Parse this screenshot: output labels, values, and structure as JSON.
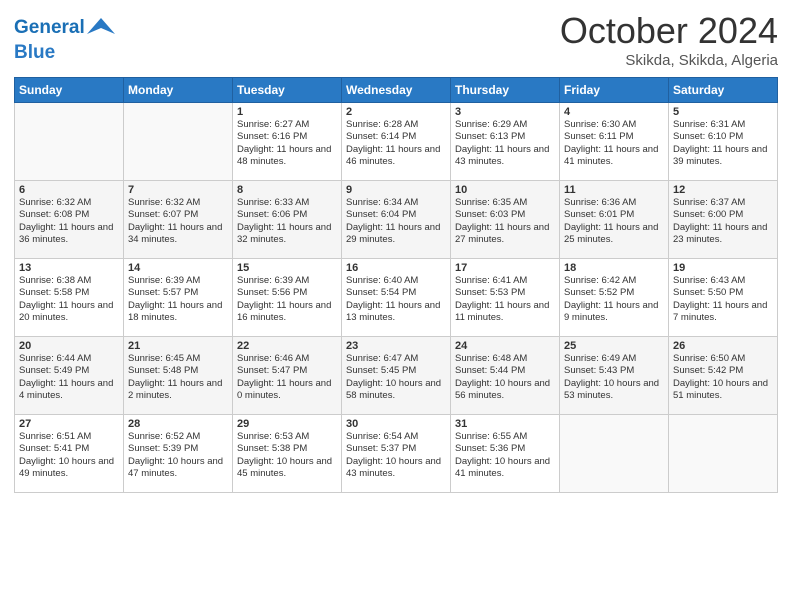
{
  "header": {
    "logo_line1": "General",
    "logo_line2": "Blue",
    "month": "October 2024",
    "location": "Skikda, Skikda, Algeria"
  },
  "weekdays": [
    "Sunday",
    "Monday",
    "Tuesday",
    "Wednesday",
    "Thursday",
    "Friday",
    "Saturday"
  ],
  "weeks": [
    [
      {
        "day": "",
        "info": ""
      },
      {
        "day": "",
        "info": ""
      },
      {
        "day": "1",
        "info": "Sunrise: 6:27 AM\nSunset: 6:16 PM\nDaylight: 11 hours and 48 minutes."
      },
      {
        "day": "2",
        "info": "Sunrise: 6:28 AM\nSunset: 6:14 PM\nDaylight: 11 hours and 46 minutes."
      },
      {
        "day": "3",
        "info": "Sunrise: 6:29 AM\nSunset: 6:13 PM\nDaylight: 11 hours and 43 minutes."
      },
      {
        "day": "4",
        "info": "Sunrise: 6:30 AM\nSunset: 6:11 PM\nDaylight: 11 hours and 41 minutes."
      },
      {
        "day": "5",
        "info": "Sunrise: 6:31 AM\nSunset: 6:10 PM\nDaylight: 11 hours and 39 minutes."
      }
    ],
    [
      {
        "day": "6",
        "info": "Sunrise: 6:32 AM\nSunset: 6:08 PM\nDaylight: 11 hours and 36 minutes."
      },
      {
        "day": "7",
        "info": "Sunrise: 6:32 AM\nSunset: 6:07 PM\nDaylight: 11 hours and 34 minutes."
      },
      {
        "day": "8",
        "info": "Sunrise: 6:33 AM\nSunset: 6:06 PM\nDaylight: 11 hours and 32 minutes."
      },
      {
        "day": "9",
        "info": "Sunrise: 6:34 AM\nSunset: 6:04 PM\nDaylight: 11 hours and 29 minutes."
      },
      {
        "day": "10",
        "info": "Sunrise: 6:35 AM\nSunset: 6:03 PM\nDaylight: 11 hours and 27 minutes."
      },
      {
        "day": "11",
        "info": "Sunrise: 6:36 AM\nSunset: 6:01 PM\nDaylight: 11 hours and 25 minutes."
      },
      {
        "day": "12",
        "info": "Sunrise: 6:37 AM\nSunset: 6:00 PM\nDaylight: 11 hours and 23 minutes."
      }
    ],
    [
      {
        "day": "13",
        "info": "Sunrise: 6:38 AM\nSunset: 5:58 PM\nDaylight: 11 hours and 20 minutes."
      },
      {
        "day": "14",
        "info": "Sunrise: 6:39 AM\nSunset: 5:57 PM\nDaylight: 11 hours and 18 minutes."
      },
      {
        "day": "15",
        "info": "Sunrise: 6:39 AM\nSunset: 5:56 PM\nDaylight: 11 hours and 16 minutes."
      },
      {
        "day": "16",
        "info": "Sunrise: 6:40 AM\nSunset: 5:54 PM\nDaylight: 11 hours and 13 minutes."
      },
      {
        "day": "17",
        "info": "Sunrise: 6:41 AM\nSunset: 5:53 PM\nDaylight: 11 hours and 11 minutes."
      },
      {
        "day": "18",
        "info": "Sunrise: 6:42 AM\nSunset: 5:52 PM\nDaylight: 11 hours and 9 minutes."
      },
      {
        "day": "19",
        "info": "Sunrise: 6:43 AM\nSunset: 5:50 PM\nDaylight: 11 hours and 7 minutes."
      }
    ],
    [
      {
        "day": "20",
        "info": "Sunrise: 6:44 AM\nSunset: 5:49 PM\nDaylight: 11 hours and 4 minutes."
      },
      {
        "day": "21",
        "info": "Sunrise: 6:45 AM\nSunset: 5:48 PM\nDaylight: 11 hours and 2 minutes."
      },
      {
        "day": "22",
        "info": "Sunrise: 6:46 AM\nSunset: 5:47 PM\nDaylight: 11 hours and 0 minutes."
      },
      {
        "day": "23",
        "info": "Sunrise: 6:47 AM\nSunset: 5:45 PM\nDaylight: 10 hours and 58 minutes."
      },
      {
        "day": "24",
        "info": "Sunrise: 6:48 AM\nSunset: 5:44 PM\nDaylight: 10 hours and 56 minutes."
      },
      {
        "day": "25",
        "info": "Sunrise: 6:49 AM\nSunset: 5:43 PM\nDaylight: 10 hours and 53 minutes."
      },
      {
        "day": "26",
        "info": "Sunrise: 6:50 AM\nSunset: 5:42 PM\nDaylight: 10 hours and 51 minutes."
      }
    ],
    [
      {
        "day": "27",
        "info": "Sunrise: 6:51 AM\nSunset: 5:41 PM\nDaylight: 10 hours and 49 minutes."
      },
      {
        "day": "28",
        "info": "Sunrise: 6:52 AM\nSunset: 5:39 PM\nDaylight: 10 hours and 47 minutes."
      },
      {
        "day": "29",
        "info": "Sunrise: 6:53 AM\nSunset: 5:38 PM\nDaylight: 10 hours and 45 minutes."
      },
      {
        "day": "30",
        "info": "Sunrise: 6:54 AM\nSunset: 5:37 PM\nDaylight: 10 hours and 43 minutes."
      },
      {
        "day": "31",
        "info": "Sunrise: 6:55 AM\nSunset: 5:36 PM\nDaylight: 10 hours and 41 minutes."
      },
      {
        "day": "",
        "info": ""
      },
      {
        "day": "",
        "info": ""
      }
    ]
  ]
}
